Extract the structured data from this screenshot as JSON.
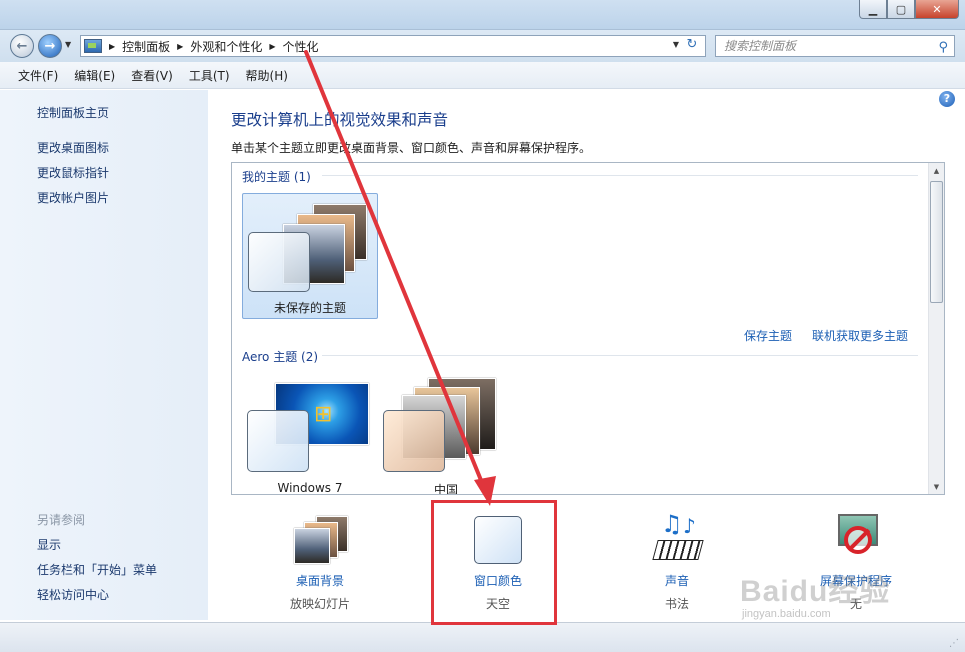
{
  "window": {
    "buttons": {
      "minimize": "▁",
      "maximize": "▢",
      "close": "✕"
    }
  },
  "address": {
    "crumbs": [
      "控制面板",
      "外观和个性化",
      "个性化"
    ],
    "search_placeholder": "搜索控制面板"
  },
  "menu": [
    "文件(F)",
    "编辑(E)",
    "查看(V)",
    "工具(T)",
    "帮助(H)"
  ],
  "sidebar": {
    "home": "控制面板主页",
    "links": [
      "更改桌面图标",
      "更改鼠标指针",
      "更改帐户图片"
    ],
    "see_also_title": "另请参阅",
    "see_also": [
      "显示",
      "任务栏和「开始」菜单",
      "轻松访问中心"
    ]
  },
  "main": {
    "title": "更改计算机上的视觉效果和声音",
    "description": "单击某个主题立即更改桌面背景、窗口颜色、声音和屏幕保护程序。",
    "my_themes_header": "我的主题 (1)",
    "my_themes": [
      {
        "label": "未保存的主题",
        "selected": true
      }
    ],
    "save_theme": "保存主题",
    "get_more_themes": "联机获取更多主题",
    "aero_header": "Aero 主题 (2)",
    "aero_themes": [
      {
        "label": "Windows 7"
      },
      {
        "label": "中国"
      }
    ]
  },
  "bottom": [
    {
      "title": "桌面背景",
      "subtitle": "放映幻灯片",
      "icon": "desktop-background-icon"
    },
    {
      "title": "窗口颜色",
      "subtitle": "天空",
      "icon": "window-color-icon"
    },
    {
      "title": "声音",
      "subtitle": "书法",
      "icon": "sound-icon"
    },
    {
      "title": "屏幕保护程序",
      "subtitle": "无",
      "icon": "screensaver-icon"
    }
  ],
  "colors": {
    "annotation_red": "#e0353c",
    "link_blue": "#1c5fb4",
    "title_blue": "#1a3e8c"
  },
  "watermark": {
    "brand": "Baidu经验",
    "url": "jingyan.baidu.com"
  }
}
